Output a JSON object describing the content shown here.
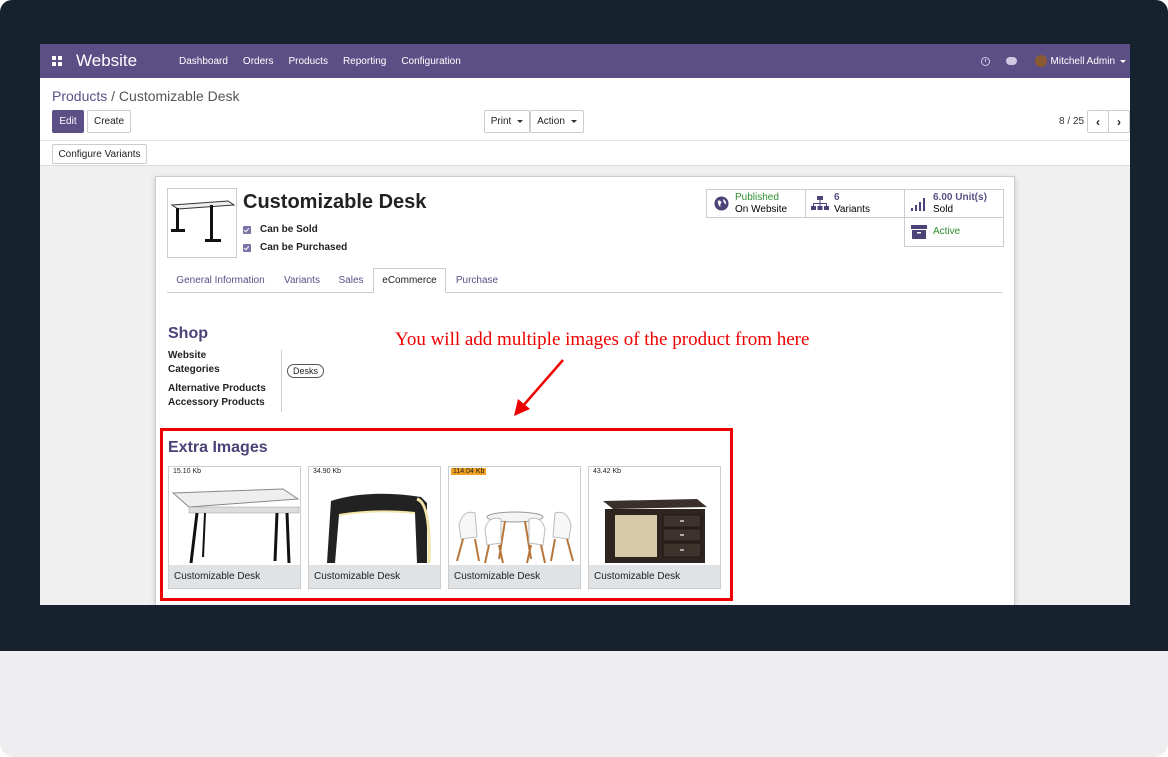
{
  "navbar": {
    "app_name": "Website",
    "menu": [
      "Dashboard",
      "Orders",
      "Products",
      "Reporting",
      "Configuration"
    ],
    "user": "Mitchell Admin",
    "icons": [
      "apps-grid-icon",
      "clock-icon",
      "chat-icon",
      "avatar"
    ]
  },
  "breadcrumb": {
    "parent": "Products",
    "separator": "/",
    "current": "Customizable Desk"
  },
  "buttons": {
    "edit": "Edit",
    "create": "Create",
    "print": "Print",
    "action": "Action",
    "configure_variants": "Configure Variants"
  },
  "pager": {
    "text": "8 / 25"
  },
  "product": {
    "name": "Customizable Desk",
    "can_be_sold": "Can be Sold",
    "can_be_purchased": "Can be Purchased"
  },
  "stats": {
    "published": {
      "line1": "Published",
      "line2": "On Website"
    },
    "variants": {
      "line1": "6",
      "line2": "Variants"
    },
    "sold": {
      "line1": "6.00 Unit(s)",
      "line2": "Sold"
    },
    "active": {
      "line1": "Active"
    }
  },
  "tabs": [
    "General Information",
    "Variants",
    "Sales",
    "eCommerce",
    "Purchase"
  ],
  "active_tab": "eCommerce",
  "shop": {
    "title": "Shop",
    "website_categories_label_1": "Website",
    "website_categories_label_2": "Categories",
    "category_tag": "Desks",
    "alternative_products_label": "Alternative Products",
    "accessory_products_label": "Accessory Products"
  },
  "annotation": "You will add multiple images of the product from here",
  "extra_images": {
    "title": "Extra Images",
    "items": [
      {
        "size": "15.10 Kb",
        "caption": "Customizable Desk",
        "highlight": false
      },
      {
        "size": "34.90 Kb",
        "caption": "Customizable Desk",
        "highlight": false
      },
      {
        "size": "114.04 Kb",
        "caption": "Customizable Desk",
        "highlight": true
      },
      {
        "size": "43.42 Kb",
        "caption": "Customizable Desk",
        "highlight": false
      }
    ]
  },
  "colors": {
    "navbar": "#5b4f86",
    "annotation": "#ee0000",
    "status_green": "#2d8f2d",
    "size_warning": "#f0a020"
  }
}
